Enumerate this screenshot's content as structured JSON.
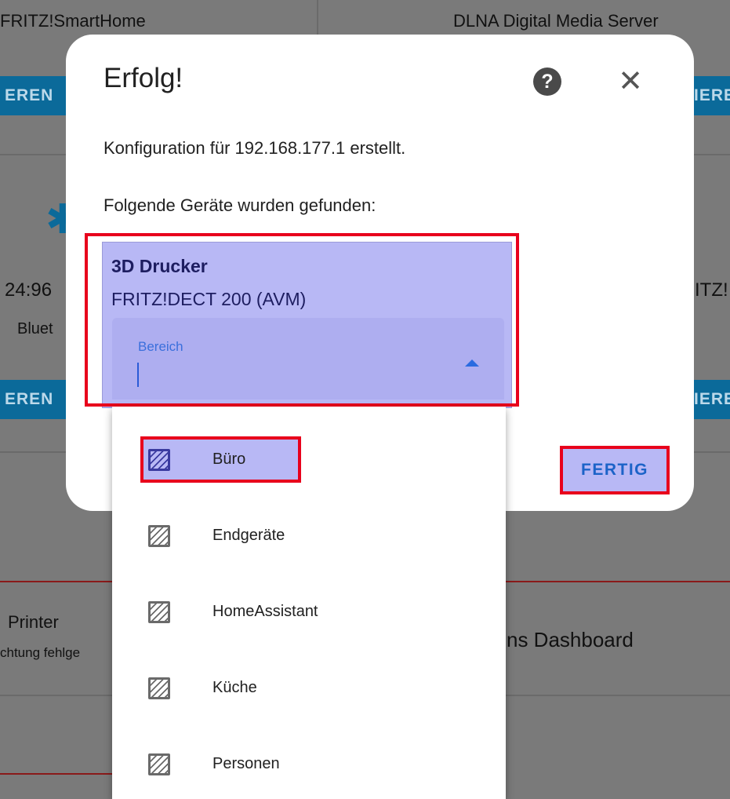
{
  "background": {
    "card1_title": "FRITZ!SmartHome",
    "card2_title": "DLNA Digital Media Server",
    "configure_slice_left": "EREN",
    "configure_slice_right": "IERE",
    "mac_fragment": "24:96",
    "bt_fragment": "Bluet",
    "fritz_fragment": "ITZ!",
    "printer_title": "Printer",
    "printer_status": "chtung fehlge",
    "dashboard_fragment": "ns Dashboard"
  },
  "dialog": {
    "title": "Erfolg!",
    "help_glyph": "?",
    "close_glyph": "✕",
    "config_message": "Konfiguration für 192.168.177.1 erstellt.",
    "found_message": "Folgende Geräte wurden gefunden:",
    "device": {
      "name": "3D Drucker",
      "model": "FRITZ!DECT 200 (AVM)"
    },
    "area_field": {
      "label": "Bereich",
      "value": ""
    },
    "done_label": "FERTIG"
  },
  "dropdown": {
    "items": [
      {
        "label": "Büro",
        "icon": "area-icon",
        "selected": true
      },
      {
        "label": "Endgeräte",
        "icon": "area-icon",
        "selected": false
      },
      {
        "label": "HomeAssistant",
        "icon": "area-icon",
        "selected": false
      },
      {
        "label": "Küche",
        "icon": "area-icon",
        "selected": false
      },
      {
        "label": "Personen",
        "icon": "area-icon",
        "selected": false
      }
    ]
  },
  "colors": {
    "highlight": "#b8b8f5",
    "annotation_red": "#e8001c",
    "accent_blue": "#1c63c8"
  }
}
